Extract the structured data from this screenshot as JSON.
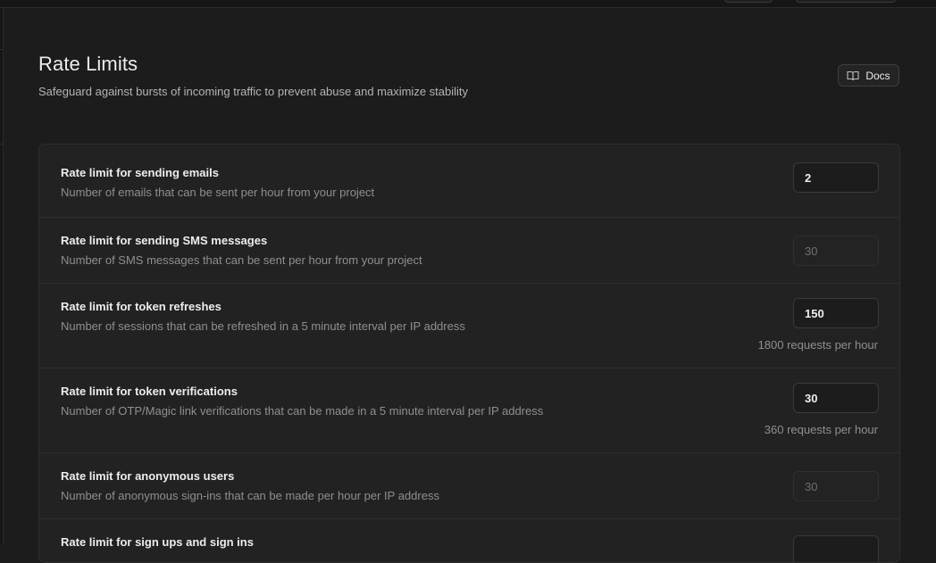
{
  "header": {
    "title": "Rate Limits",
    "subtitle": "Safeguard against bursts of incoming traffic to prevent abuse and maximize stability",
    "docs_label": "Docs",
    "docs_icon": "book-open-icon"
  },
  "rows": [
    {
      "label": "Rate limit for sending emails",
      "description": "Number of emails that can be sent per hour from your project",
      "value": "2",
      "disabled": false,
      "hint": ""
    },
    {
      "label": "Rate limit for sending SMS messages",
      "description": "Number of SMS messages that can be sent per hour from your project",
      "value": "30",
      "disabled": true,
      "hint": ""
    },
    {
      "label": "Rate limit for token refreshes",
      "description": "Number of sessions that can be refreshed in a 5 minute interval per IP address",
      "value": "150",
      "disabled": false,
      "hint": "1800 requests per hour"
    },
    {
      "label": "Rate limit for token verifications",
      "description": "Number of OTP/Magic link verifications that can be made in a 5 minute interval per IP address",
      "value": "30",
      "disabled": false,
      "hint": "360 requests per hour"
    },
    {
      "label": "Rate limit for anonymous users",
      "description": "Number of anonymous sign-ins that can be made per hour per IP address",
      "value": "30",
      "disabled": true,
      "hint": ""
    },
    {
      "label": "Rate limit for sign ups and sign ins",
      "description": "",
      "value": "",
      "disabled": false,
      "hint": ""
    }
  ],
  "colors": {
    "background": "#1c1c1c",
    "card": "#222222",
    "border": "#2e2e2e",
    "text_primary": "#ededed",
    "text_muted": "#8f8f8f"
  }
}
